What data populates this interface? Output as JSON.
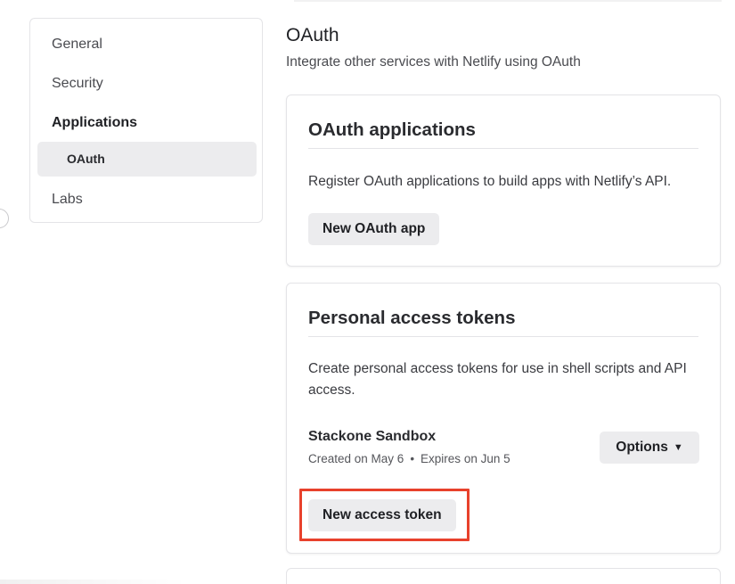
{
  "sidebar": {
    "items": [
      {
        "label": "General"
      },
      {
        "label": "Security"
      },
      {
        "label": "Applications"
      },
      {
        "label": "Labs"
      }
    ],
    "sub_item": {
      "label": "OAuth"
    }
  },
  "header": {
    "title": "OAuth",
    "subtitle": "Integrate other services with Netlify using OAuth"
  },
  "oauth_card": {
    "title": "OAuth applications",
    "description": "Register OAuth applications to build apps with Netlify’s API.",
    "button_label": "New OAuth app"
  },
  "tokens_card": {
    "title": "Personal access tokens",
    "description": "Create personal access tokens for use in shell scripts and API access.",
    "token": {
      "name": "Stackone Sandbox",
      "created": "Created on May 6",
      "separator": "•",
      "expires": "Expires on Jun 5"
    },
    "options_label": "Options",
    "new_token_label": "New access token"
  },
  "colors": {
    "highlight": "#e8412c",
    "button_bg": "#ececee"
  },
  "icons": {
    "options": "chevron-down-icon"
  }
}
